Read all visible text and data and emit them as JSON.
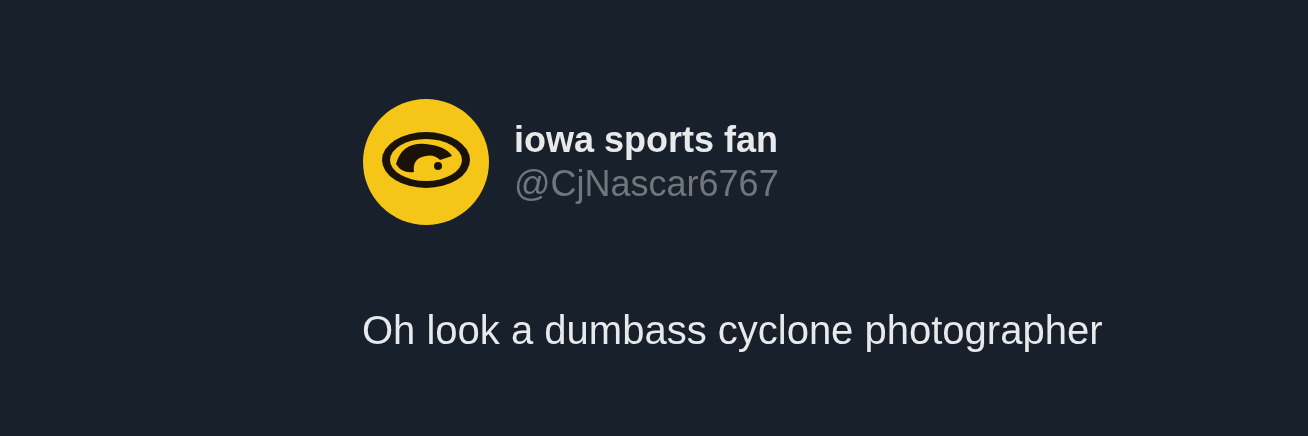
{
  "author": {
    "name": "iowa sports fan",
    "handle": "@CjNascar6767"
  },
  "tweet": {
    "text": "Oh look a dumbass cyclone photographer"
  }
}
